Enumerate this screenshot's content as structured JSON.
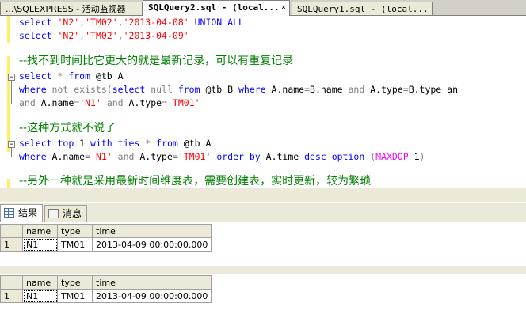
{
  "tabs": [
    {
      "label": "...\\SQLEXPRESS - 活动监视器",
      "active": false,
      "close": ""
    },
    {
      "label": "SQLQuery2.sql - (local...",
      "active": true,
      "close": "×"
    },
    {
      "label": "SQLQuery1.sql - (local...",
      "active": false,
      "close": ""
    }
  ],
  "editor": {
    "l1": {
      "a": "select ",
      "b": "'N2'",
      "c": ",",
      "d": "'TM02'",
      "e": ",",
      "f": "'2013-04-08'",
      "g": " UNION ALL"
    },
    "l2": {
      "a": "select ",
      "b": "'N2'",
      "c": ",",
      "d": "'TM02'",
      "e": ",",
      "f": "'2013-04-09'"
    },
    "c1": "--找不到时间比它更大的就是最新记录，可以有重复记录",
    "l3": {
      "a": "select ",
      "b": "*",
      "c": " from ",
      "d": "@tb A"
    },
    "l4": {
      "a": "where ",
      "b": "not exists",
      "c": "(",
      "d": "select ",
      "e": "null",
      "f": " from ",
      "g": "@tb B ",
      "h": "where ",
      "i": "A.name",
      "j": "=",
      "k": "B.name ",
      "l": "and ",
      "m": "A.type",
      "n": "=",
      "o": "B.type an"
    },
    "l5": {
      "a": "and ",
      "b": "A.name",
      "c": "=",
      "d": "'N1'",
      "e": " and ",
      "f": "A.type",
      "g": "=",
      "h": "'TM01'"
    },
    "c2": "--这种方式就不说了",
    "l6": {
      "a": "select ",
      "b": "top ",
      "c": "1 ",
      "d": "with ",
      "e": "ties ",
      "f": "* ",
      "g": "from ",
      "h": "@tb A"
    },
    "l7": {
      "a": "where ",
      "b": "A.name",
      "c": "=",
      "d": "'N1'",
      "e": " and ",
      "f": "A.type",
      "g": "=",
      "h": "'TM01'",
      "i": " order by ",
      "j": "A.time ",
      "k": "desc ",
      "l": "option ",
      "m": "(",
      "n": "MAXDOP ",
      "o": "1",
      "p": ")"
    },
    "c3": "--另外一种就是采用最新时间维度表，需要创建表，实时更新，较为繁琐"
  },
  "result_tabs": [
    {
      "label": "结果",
      "icon": "grid-icon",
      "active": true
    },
    {
      "label": "消息",
      "icon": "message-icon",
      "active": false
    }
  ],
  "grid1": {
    "columns": [
      "name",
      "type",
      "time"
    ],
    "rows": [
      {
        "rn": "1",
        "name": "N1",
        "type": "TM01",
        "time": "2013-04-09 00:00:00.000"
      }
    ]
  },
  "grid2": {
    "columns": [
      "name",
      "type",
      "time"
    ],
    "rows": [
      {
        "rn": "1",
        "name": "N1",
        "type": "TM01",
        "time": "2013-04-09 00:00:00.000"
      }
    ]
  },
  "colors": {
    "keyword": "#0000ff",
    "string": "#ff0000",
    "comment": "#008000",
    "operator": "#808080"
  }
}
